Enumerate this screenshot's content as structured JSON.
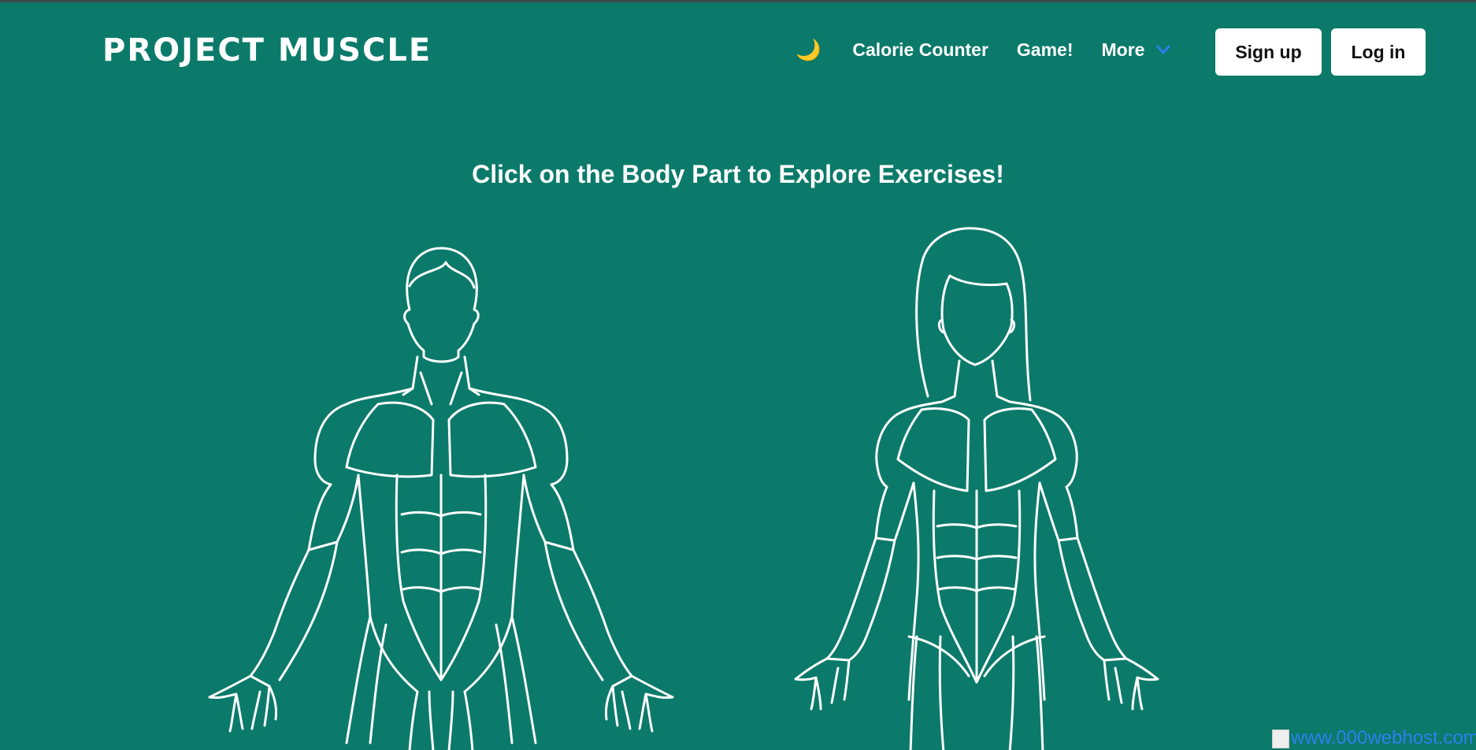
{
  "header": {
    "brand": "PROJECT MUSCLE",
    "theme_toggle_icon": "moon-icon",
    "nav": {
      "calorie_counter": "Calorie Counter",
      "game": "Game!",
      "more": "More"
    },
    "sign_up": "Sign up",
    "log_in": "Log in"
  },
  "main": {
    "heading": "Click on the Body Part to Explore Exercises!"
  },
  "footer": {
    "hosting_badge_alt": "www.000webhost.com"
  },
  "colors": {
    "background": "#0b7a6a",
    "moon": "#f2cc33",
    "chevron": "#2f7ff0",
    "button_bg": "#ffffff"
  }
}
